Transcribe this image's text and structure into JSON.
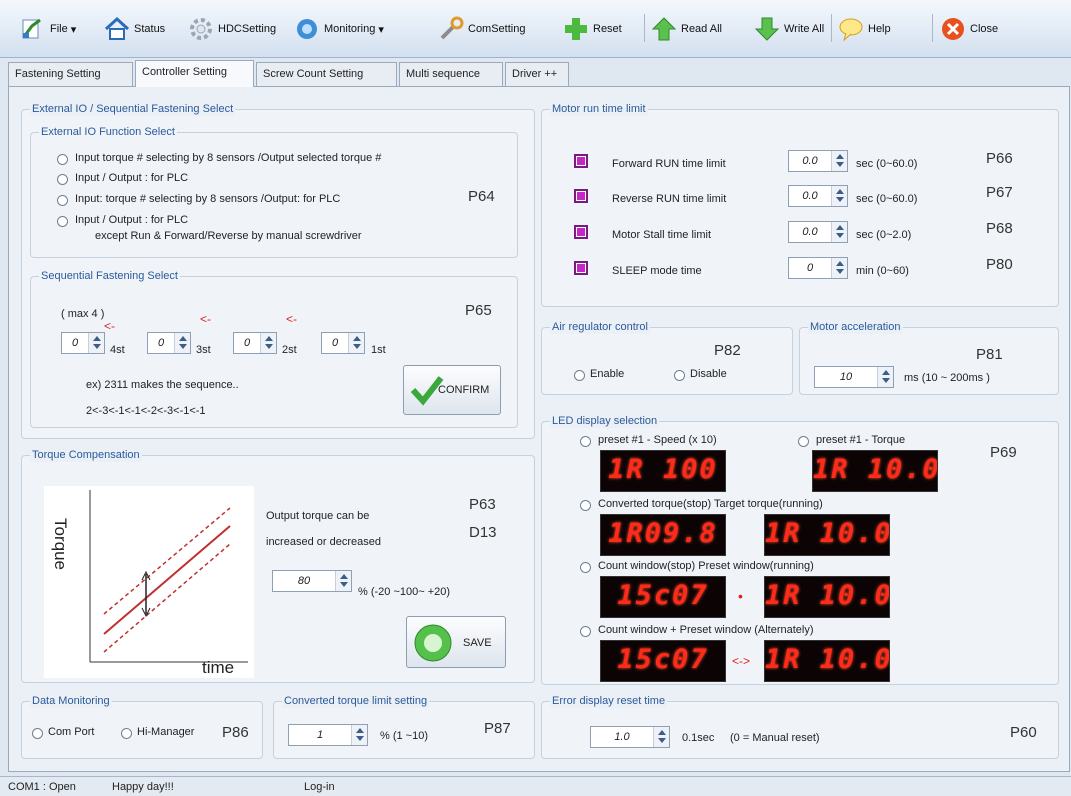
{
  "toolbar": {
    "file": "File",
    "status": "Status",
    "hdc": "HDCSetting",
    "monitoring": "Monitoring",
    "comsetting": "ComSetting",
    "reset": "Reset",
    "readall": "Read All",
    "writeall": "Write All",
    "help": "Help",
    "close": "Close"
  },
  "tabs": [
    "Fastening Setting",
    "Controller Setting",
    "Screw Count Setting",
    "Multi sequence",
    "Driver ++"
  ],
  "extio": {
    "title": "External IO / Sequential Fastening Select",
    "func_title": "External IO Function Select",
    "opt1": "Input torque # selecting by 8 sensors /Output selected torque #",
    "opt2": "Input / Output : for PLC",
    "opt3": "Input: torque # selecting by 8 sensors /Output: for PLC",
    "opt4a": "Input / Output : for PLC",
    "opt4b": "except Run & Forward/Reverse by manual screwdriver",
    "param": "P64"
  },
  "seq": {
    "title": "Sequential Fastening Select",
    "max": "( max 4 )",
    "param": "P65",
    "v1": "0",
    "v2": "0",
    "v3": "0",
    "v4": "0",
    "l4": "4st",
    "l3": "3st",
    "l2": "2st",
    "l1": "1st",
    "arrow": "<-",
    "ex1": "ex) 2311 makes the sequence..",
    "ex2": "2<-3<-1<-1<-2<-3<-1<-1",
    "confirm": "CONFIRM"
  },
  "torque": {
    "title": "Torque Compensation",
    "ylabel": "Torque",
    "xlabel": "time",
    "p1": "P63",
    "p2": "D13",
    "desc1": "Output torque can be",
    "desc2": "increased or decreased",
    "value": "80",
    "unit": "% (-20 ~100~ +20)",
    "save": "SAVE"
  },
  "datamon": {
    "title": "Data Monitoring",
    "com": "Com Port",
    "hi": "Hi-Manager",
    "param": "P86"
  },
  "conv": {
    "title": "Converted torque limit setting",
    "value": "1",
    "unit": "% (1 ~10)",
    "param": "P87"
  },
  "motor": {
    "title": "Motor run time limit",
    "rows": [
      {
        "label": "Forward RUN time limit",
        "value": "0.0",
        "unit": "sec (0~60.0)",
        "param": "P66"
      },
      {
        "label": "Reverse RUN time limit",
        "value": "0.0",
        "unit": "sec (0~60.0)",
        "param": "P67"
      },
      {
        "label": "Motor Stall time limit",
        "value": "0.0",
        "unit": "sec (0~2.0)",
        "param": "P68"
      },
      {
        "label": "SLEEP mode time",
        "value": "0",
        "unit": "min (0~60)",
        "param": "P80"
      }
    ]
  },
  "air": {
    "title": "Air regulator control",
    "param": "P82",
    "enable": "Enable",
    "disable": "Disable"
  },
  "accel": {
    "title": "Motor acceleration",
    "param": "P81",
    "value": "10",
    "unit": "ms  (10 ~ 200ms )"
  },
  "led": {
    "title": "LED display selection",
    "param": "P69",
    "opt1": "preset #1 - Speed (x 10)",
    "opt2": "preset #1 - Torque",
    "opt3": "Converted torque(stop) Target torque(running)",
    "opt4": "Count window(stop) Preset window(running)",
    "opt5": "Count window + Preset window (Alternately)",
    "d1": "1R 100",
    "d2": "1R 10.0",
    "d3": "1R09.8",
    "d4": "1R 10.0",
    "d5": "15c07",
    "d6": "1R 10.0",
    "d7": "15c07",
    "d8": "1R 10.0",
    "dot": "•",
    "swap": "<->"
  },
  "err": {
    "title": "Error display reset time",
    "value": "1.0",
    "unit": "0.1sec",
    "note": "(0 = Manual reset)",
    "param": "P60"
  },
  "status": {
    "port": "COM1 : Open",
    "msg": "Happy day!!!",
    "login": "Log-in"
  }
}
